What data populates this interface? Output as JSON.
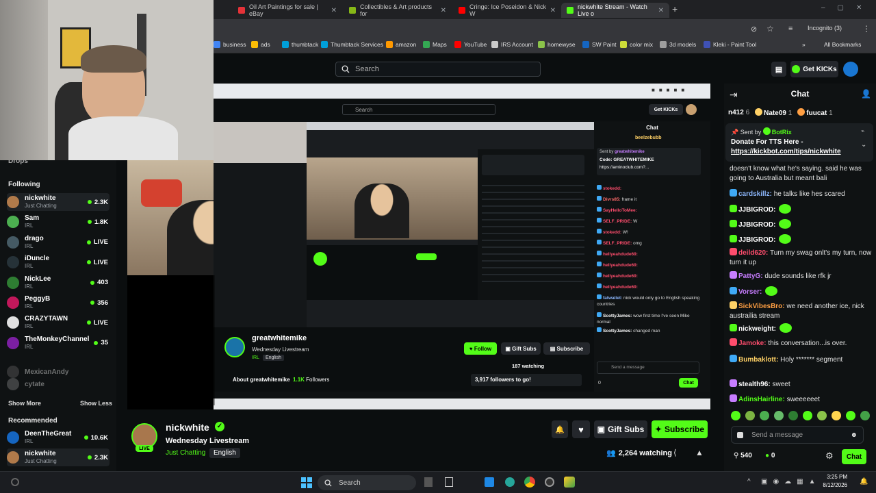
{
  "browser": {
    "tabs": [
      {
        "title": "Oil Art Paintings for sale | eBay",
        "color": "#e53238"
      },
      {
        "title": "Collectibles & Art products for",
        "color": "#86b817"
      },
      {
        "title": "Cringe: Ice Poseidon & Nick W",
        "color": "#ff0000"
      },
      {
        "title": "nickwhite Stream - Watch Live o",
        "color": "#53fc18"
      }
    ],
    "incognito": "Incognito (3)",
    "bookmarks": [
      {
        "label": "business",
        "color": "#4285f4"
      },
      {
        "label": "ads",
        "color": "#fbbc04"
      },
      {
        "label": "thumbtack",
        "color": "#009fd9"
      },
      {
        "label": "Thumbtack Services",
        "color": "#009fd9"
      },
      {
        "label": "amazon",
        "color": "#ff9900"
      },
      {
        "label": "Maps",
        "color": "#34a853"
      },
      {
        "label": "YouTube",
        "color": "#ff0000"
      },
      {
        "label": "IRS Account",
        "color": "#cccccc"
      },
      {
        "label": "homewyse",
        "color": "#8bc34a"
      },
      {
        "label": "SW Paint",
        "color": "#1565c0"
      },
      {
        "label": "color mix",
        "color": "#cddc39"
      },
      {
        "label": "3d models",
        "color": "#9e9e9e"
      },
      {
        "label": "Kleki - Paint Tool",
        "color": "#3f51b5"
      }
    ],
    "all_bookmarks": "All Bookmarks"
  },
  "header": {
    "search_placeholder": "Search",
    "get_kicks": "Get KICKs"
  },
  "sidebar": {
    "drops": "Drops",
    "following_title": "Following",
    "following": [
      {
        "name": "nickwhite",
        "cat": "Just Chatting",
        "count": "2.3K",
        "color": "#b07a4a"
      },
      {
        "name": "Sam",
        "cat": "IRL",
        "count": "1.8K",
        "color": "#4caf50"
      },
      {
        "name": "drago",
        "cat": "IRL",
        "count": "LIVE",
        "color": "#455a64"
      },
      {
        "name": "iDuncle",
        "cat": "IRL",
        "count": "LIVE",
        "color": "#263238"
      },
      {
        "name": "NickLee",
        "cat": "IRL",
        "count": "403",
        "color": "#2e7d32"
      },
      {
        "name": "PeggyB",
        "cat": "IRL",
        "count": "356",
        "color": "#c2185b"
      },
      {
        "name": "CRAZYTAWN",
        "cat": "IRL",
        "count": "LIVE",
        "color": "#e0e0e0"
      },
      {
        "name": "TheMonkeyChannel",
        "cat": "IRL",
        "count": "35",
        "color": "#7b1fa2"
      }
    ],
    "offline": [
      "MexicanAndy",
      "cytate"
    ],
    "show_more": "Show More",
    "show_less": "Show Less",
    "recommended_title": "Recommended",
    "recommended": [
      {
        "name": "DeenTheGreat",
        "cat": "IRL",
        "count": "10.6K",
        "color": "#1565c0"
      },
      {
        "name": "nickwhite",
        "cat": "Just Chatting",
        "count": "2.3K",
        "color": "#b07a4a"
      }
    ]
  },
  "stream": {
    "channel": "nickwhite",
    "title": "Wednesday Livestream",
    "category": "Just Chatting",
    "language": "English",
    "live": "LIVE",
    "gift_subs": "Gift Subs",
    "subscribe": "Subscribe",
    "watching": "2,264 watching"
  },
  "inner": {
    "channel": "greatwhitemike",
    "title": "Wednesday Livestream",
    "category": "IRL",
    "language": "English",
    "follow": "Follow",
    "gift_subs": "Gift Subs",
    "subscribe": "Subscribe",
    "watching": "187 watching",
    "about": "About greatwhitemike",
    "followers_count": "1.1K",
    "followers_label": "Followers",
    "goal": "3,917 followers to go!",
    "search": "Search",
    "get_kicks": "Get KICKs",
    "chat_title": "Chat",
    "pinned_user": "beelzebubb",
    "sent_by": "Sent by",
    "pinned_sender": "greatwhitemike",
    "pinned_text": "Code: GREATWHITEMIKE",
    "pinned_link": "https://aminoclub.com?...",
    "send_message": "Send a message",
    "chat_btn": "Chat",
    "points": "0",
    "messages": [
      {
        "user": "stokedd:",
        "text": "",
        "color": "#ff4d6d"
      },
      {
        "user": "Divrs85:",
        "text": "frame it",
        "color": "#ff6b6b"
      },
      {
        "user": "SayHelloToMee:",
        "text": "",
        "color": "#ff4d6d"
      },
      {
        "user": "SELF_PRIDE:",
        "text": "W",
        "color": "#ff4d6d"
      },
      {
        "user": "stokedd:",
        "text": "W!",
        "color": "#ff4d6d"
      },
      {
        "user": "SELF_PRIDE:",
        "text": "omg",
        "color": "#ff4d6d"
      },
      {
        "user": "hellyeahdude69:",
        "text": "",
        "color": "#ff4d6d"
      },
      {
        "user": "hellyeahdude69:",
        "text": "",
        "color": "#ff4d6d"
      },
      {
        "user": "hellyeahdude69:",
        "text": "",
        "color": "#ff4d6d"
      },
      {
        "user": "hellyeahdude69:",
        "text": "",
        "color": "#ff4d6d"
      },
      {
        "user": "fatwallet:",
        "text": "nick would only go to English speaking countries",
        "color": "#8ab4f8"
      },
      {
        "user": "ScottyJames:",
        "text": "wow first time I've seen Mike normal",
        "color": "#ffffff"
      },
      {
        "user": "ScottyJames:",
        "text": "changed man",
        "color": "#ffffff"
      }
    ]
  },
  "chat": {
    "title": "Chat",
    "top_gifters": [
      {
        "name": "n412",
        "count": "6"
      },
      {
        "name": "Nate09",
        "count": "1"
      },
      {
        "name": "fuucat",
        "count": "1"
      }
    ],
    "pinned_label": "Sent by",
    "pinned_sender": "BotRix",
    "pinned_title": "Donate For TTS Here -",
    "pinned_link": "https://kickbot.com/tips/nickwhite",
    "first_msg": "doesn't know what he's saying. said he was going to Australia but meant bali",
    "messages": [
      {
        "user": "cardskillz:",
        "text": "he talks like hes scared",
        "color": "#8ab4f8",
        "badge": "34"
      },
      {
        "user": "JJBIGROD:",
        "text": "",
        "color": "#ffffff"
      },
      {
        "user": "JJBIGROD:",
        "text": "",
        "color": "#ffffff"
      },
      {
        "user": "JJBIGROD:",
        "text": "",
        "color": "#ffffff"
      },
      {
        "user": "deild620:",
        "text": "Turn my swag onlt's my turn, now turn it up",
        "color": "#ff4d6d"
      },
      {
        "user": "PattyG:",
        "text": "dude sounds like rfk jr",
        "color": "#c77dff"
      },
      {
        "user": "Vorser:",
        "text": "",
        "color": "#c77dff"
      },
      {
        "user": "SickVibesBro:",
        "text": "we need another ice, nick austrailia stream",
        "color": "#ff9f43"
      },
      {
        "user": "nickweight:",
        "text": "",
        "color": "#ffffff"
      },
      {
        "user": "Jamoke:",
        "text": "this conversation...is over.",
        "color": "#ff4d6d"
      },
      {
        "user": "Bumbaklott:",
        "text": "Holy ******* segment",
        "color": "#ffd166"
      },
      {
        "user": "stealth96:",
        "text": "sweet",
        "color": "#ffffff"
      },
      {
        "user": "AdinsHairline:",
        "text": "sweeeeeet",
        "color": "#53fc18"
      }
    ],
    "send_placeholder": "Send a message",
    "points": "540",
    "kicks": "0",
    "chat_button": "Chat"
  },
  "taskbar": {
    "search": "Search",
    "time": "3:25 PM",
    "date": "8/12/2026"
  },
  "colors": {
    "kick_green": "#53fc18",
    "background": "#0b0e0f"
  }
}
